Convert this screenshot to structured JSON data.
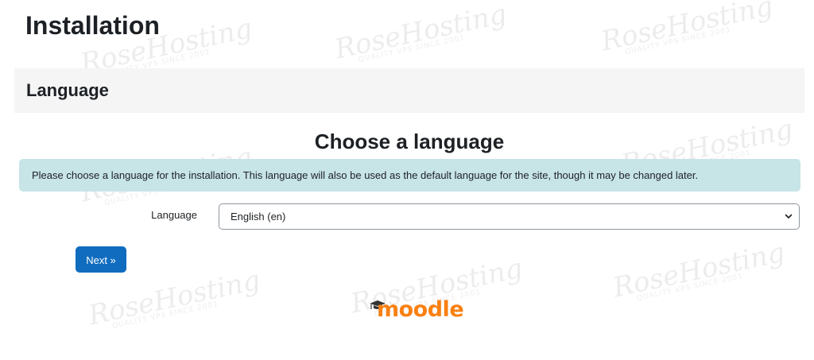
{
  "page": {
    "title": "Installation"
  },
  "section": {
    "title": "Language"
  },
  "main": {
    "heading": "Choose a language",
    "notice": "Please choose a language for the installation. This language will also be used as the default language for the site, though it may be changed later.",
    "language_label": "Language",
    "language_select": {
      "value": "English (en)"
    },
    "next_label": "Next »"
  },
  "footer": {
    "logo_text": "moodle",
    "logo_icon": "graduation-cap-icon"
  },
  "watermark": {
    "brand": "RoseHosting",
    "tagline": "QUALITY VPS SINCE 2001"
  },
  "colors": {
    "accent": "#0f6cbf",
    "notice_bg": "#c7e4e7",
    "section_bg": "#f5f5f6",
    "logo": "#f98012"
  }
}
